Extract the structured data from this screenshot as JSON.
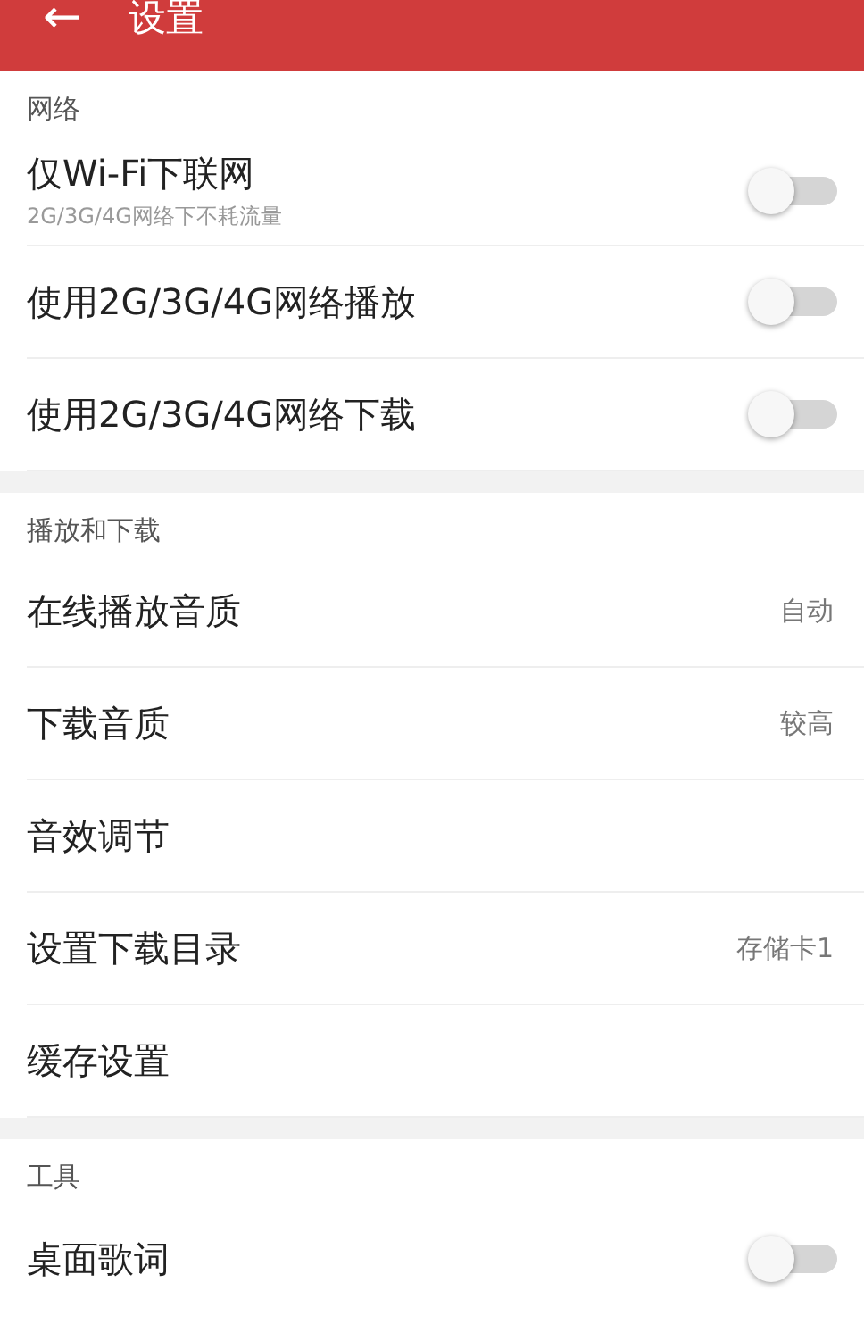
{
  "header": {
    "back_icon": "←",
    "title": "设置"
  },
  "sections": [
    {
      "title": "网络",
      "items": [
        {
          "kind": "toggle",
          "label": "仅Wi-Fi下联网",
          "subtitle": "2G/3G/4G网络下不耗流量",
          "on": false
        },
        {
          "kind": "toggle",
          "label": "使用2G/3G/4G网络播放",
          "on": false
        },
        {
          "kind": "toggle",
          "label": "使用2G/3G/4G网络下载",
          "on": false
        }
      ]
    },
    {
      "title": "播放和下载",
      "items": [
        {
          "kind": "value",
          "label": "在线播放音质",
          "value": "自动"
        },
        {
          "kind": "value",
          "label": "下载音质",
          "value": "较高"
        },
        {
          "kind": "link",
          "label": "音效调节"
        },
        {
          "kind": "value",
          "label": "设置下载目录",
          "value": "存储卡1"
        },
        {
          "kind": "link",
          "label": "缓存设置"
        }
      ]
    },
    {
      "title": "工具",
      "items": [
        {
          "kind": "toggle",
          "label": "桌面歌词",
          "on": false
        }
      ]
    }
  ]
}
